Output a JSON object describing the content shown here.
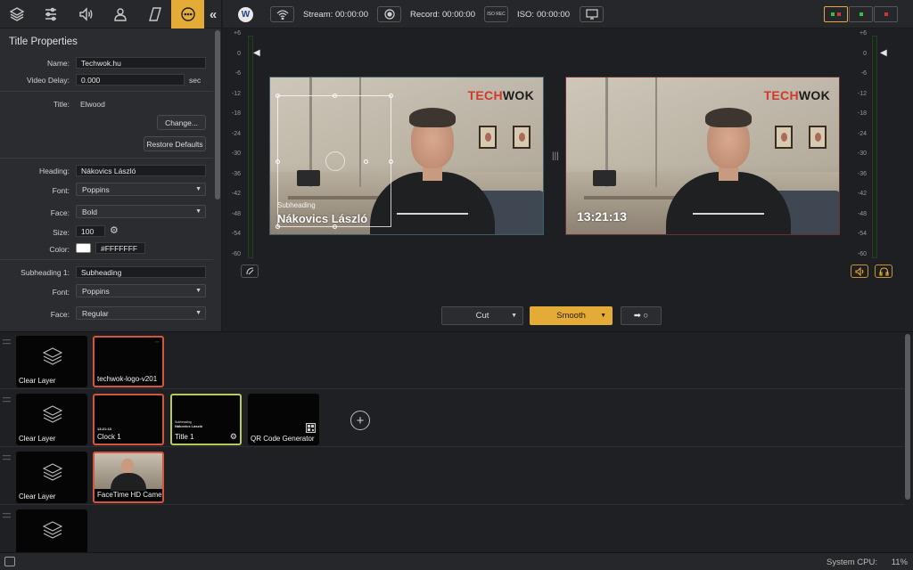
{
  "left_tabs": [
    {
      "name": "layers-icon"
    },
    {
      "name": "sliders-icon"
    },
    {
      "name": "speaker-icon"
    },
    {
      "name": "person-icon"
    },
    {
      "name": "parallelogram-icon"
    },
    {
      "name": "more-icon",
      "active": true
    }
  ],
  "collapse_glyph": "«",
  "properties": {
    "title": "Title Properties",
    "name_label": "Name:",
    "name_value": "Techwok.hu",
    "delay_label": "Video Delay:",
    "delay_value": "0.000",
    "delay_unit": "sec",
    "title_label": "Title:",
    "title_value": "Elwood",
    "change_button": "Change...",
    "restore_button": "Restore Defaults",
    "heading_label": "Heading:",
    "heading_value": "Nákovics László",
    "font_label": "Font:",
    "font_value": "Poppins",
    "face_label": "Face:",
    "face_value": "Bold",
    "size_label": "Size:",
    "size_value": "100",
    "color_label": "Color:",
    "color_value": "#FFFFFFF",
    "sub1_label": "Subheading 1:",
    "sub1_value": "Subheading",
    "font2_label": "Font:",
    "font2_value": "Poppins",
    "face2_label": "Face:",
    "face2_value": "Regular"
  },
  "topbar": {
    "stream_label": "Stream:",
    "stream_time": "00:00:00",
    "record_label": "Record:",
    "record_time": "00:00:00",
    "iso_icon_text": "ISO REC",
    "iso_label": "ISO:",
    "iso_time": "00:00:00",
    "mode_colors": [
      "#3fbf3f",
      "#d0392a"
    ]
  },
  "meter_scale": [
    "+6",
    "0",
    "-6",
    "-12",
    "-18",
    "-24",
    "-30",
    "-36",
    "-42",
    "-48",
    "-54",
    "-60"
  ],
  "preview": {
    "brand_part1": "TECH",
    "brand_part2": "WOK",
    "subheading": "Subheading",
    "heading": "Nákovics László"
  },
  "program": {
    "brand_part1": "TECH",
    "brand_part2": "WOK",
    "clock": "13:21:13"
  },
  "transition": {
    "cut": "Cut",
    "smooth": "Smooth",
    "arrow": "➡ ○"
  },
  "layers": [
    {
      "clear": "Clear Layer",
      "sources": [
        {
          "name": "techwok-logo-v201",
          "state": "live"
        }
      ]
    },
    {
      "clear": "Clear Layer",
      "sources": [
        {
          "name": "Clock 1",
          "state": "live",
          "mini": "13:21:13"
        },
        {
          "name": "Title 1",
          "state": "preview",
          "mini_sub": "Subheading",
          "mini_head": "Nákovics László"
        },
        {
          "name": "QR Code Generator",
          "state": "off"
        }
      ]
    },
    {
      "clear": "Clear Layer",
      "sources": [
        {
          "name": "FaceTime HD Came",
          "state": "live"
        }
      ]
    },
    {
      "clear": "",
      "sources": []
    }
  ],
  "footer": {
    "cpu_label": "System CPU:",
    "cpu_value": "11%"
  },
  "colors": {
    "accent": "#e4ac36",
    "live": "#d5553c",
    "preview": "#b6cc5a"
  }
}
